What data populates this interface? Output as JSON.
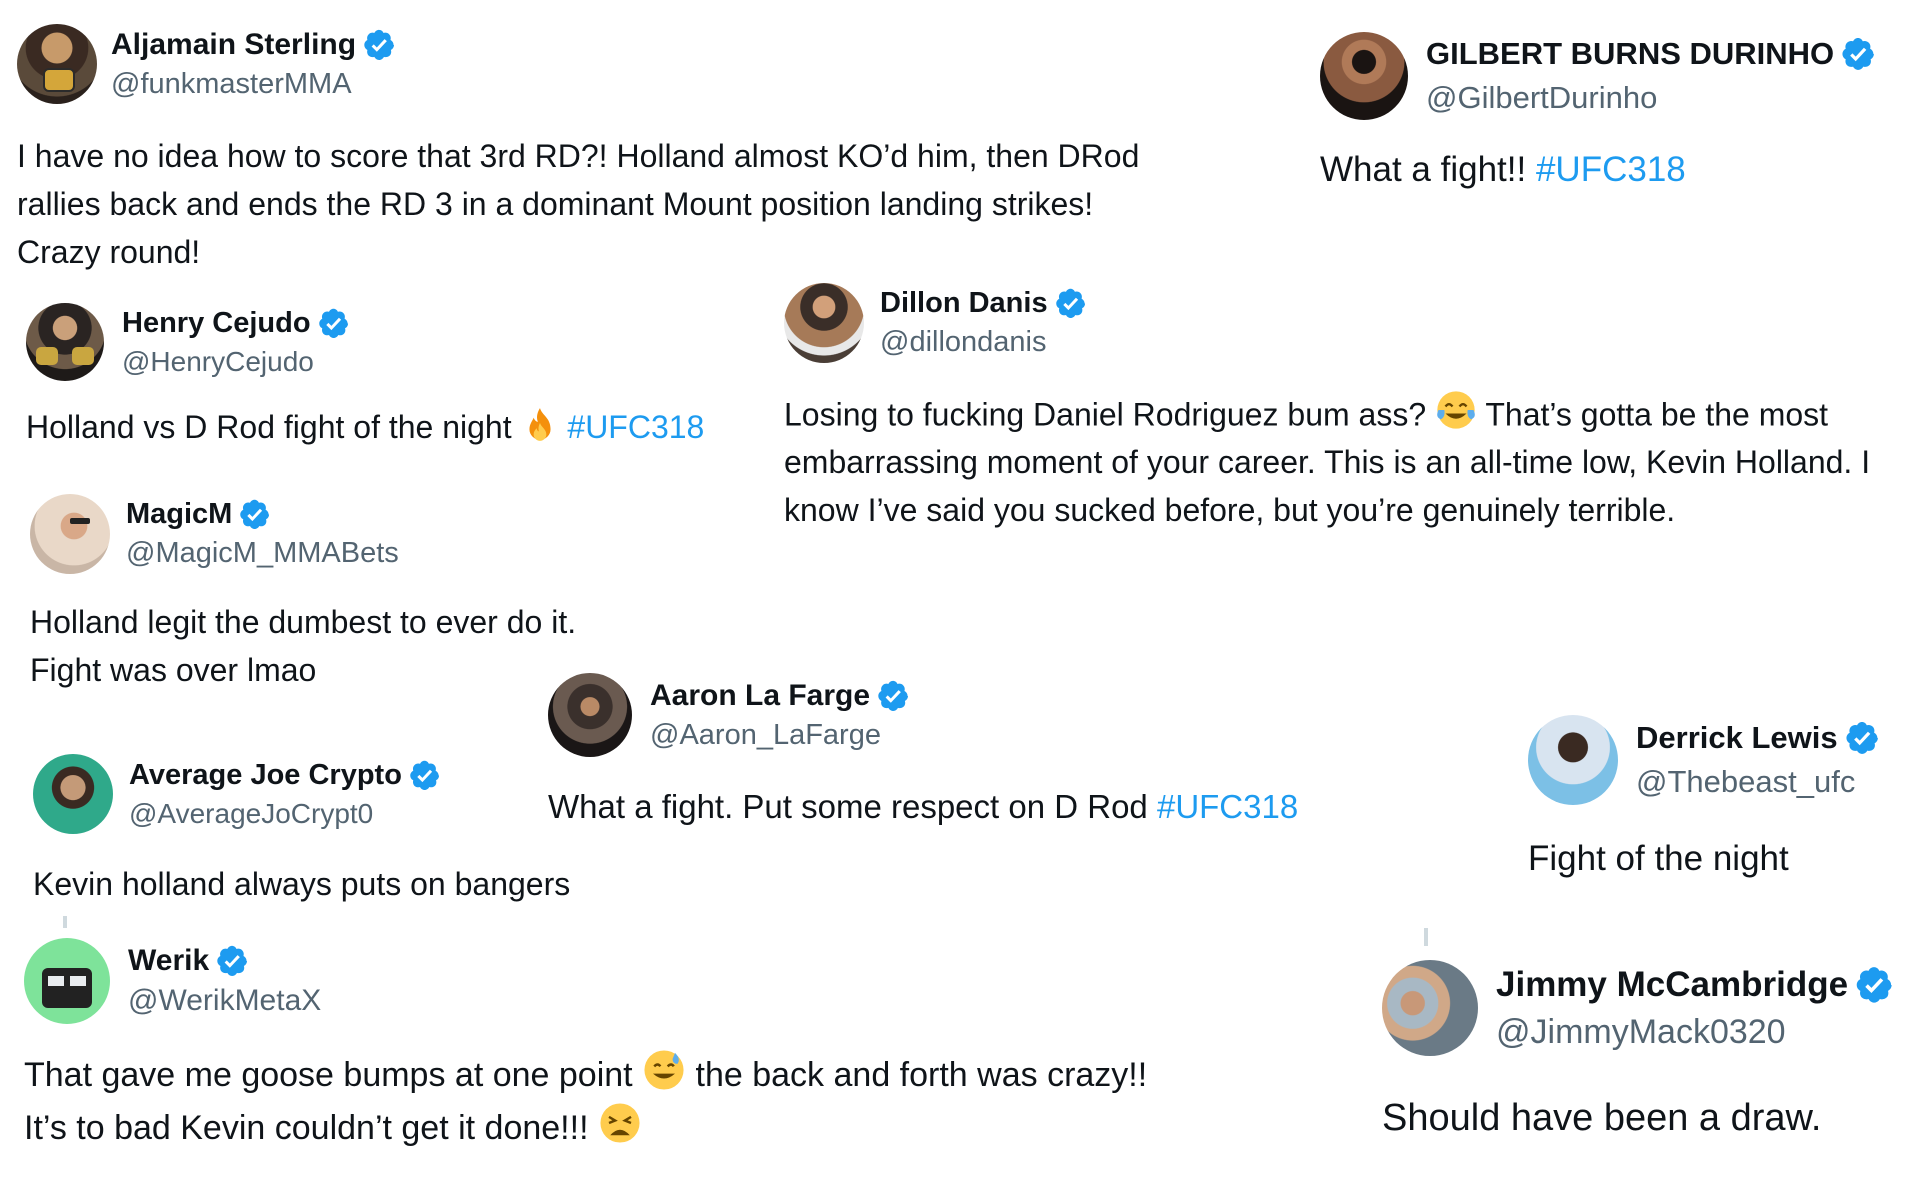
{
  "tweets": [
    {
      "name": "Aljamain Sterling",
      "handle": "@funkmasterMMA",
      "text": "I have no idea how to score that 3rd RD?! Holland almost KO’d him, then DRod rallies back and ends the RD 3 in a dominant Mount position landing strikes! Crazy round!"
    },
    {
      "name": "GILBERT BURNS DURINHO",
      "handle": "@GilbertDurinho",
      "text": "What a fight!!",
      "hashtag": "#UFC318"
    },
    {
      "name": "Henry Cejudo",
      "handle": "@HenryCejudo",
      "text": "Holland vs D Rod fight of the night",
      "emoji": "fire",
      "hashtag": "#UFC318"
    },
    {
      "name": "Dillon Danis",
      "handle": "@dillondanis",
      "text_before": "Losing to fucking Daniel Rodriguez bum ass?",
      "emoji": "face-with-tears-of-joy",
      "text_after": "That’s gotta be the most embarrassing moment of your career. This is an all-time low, Kevin Holland. I know I’ve said you sucked before, but you’re genuinely terrible."
    },
    {
      "name": "MagicM",
      "handle": "@MagicM_MMABets",
      "line1": "Holland legit the dumbest to ever do it.",
      "line2": "Fight was over lmao"
    },
    {
      "name": "Aaron La Farge",
      "handle": "@Aaron_LaFarge",
      "text": "What a fight. Put some respect on D Rod",
      "hashtag": "#UFC318"
    },
    {
      "name": "Average Joe Crypto",
      "handle": "@AverageJoCrypt0",
      "text": "Kevin holland always puts on bangers"
    },
    {
      "name": "Derrick Lewis",
      "handle": "@Thebeast_ufc",
      "text": "Fight of the night"
    },
    {
      "name": "Werik",
      "handle": "@WerikMetaX",
      "text_before": "That gave me goose bumps at one point",
      "emoji1": "grinning-face-with-sweat",
      "text_after": "the back and forth was crazy!! It’s to bad Kevin couldn’t get it done!!!",
      "emoji2": "weary-face"
    },
    {
      "name": "Jimmy McCambridge",
      "handle": "@JimmyMack0320",
      "text": "Should have been a draw."
    }
  ],
  "colors": {
    "text": "#0f1419",
    "handle": "#536471",
    "hashtag": "#1d9bf0",
    "verified_badge": "#1d9bf0"
  }
}
